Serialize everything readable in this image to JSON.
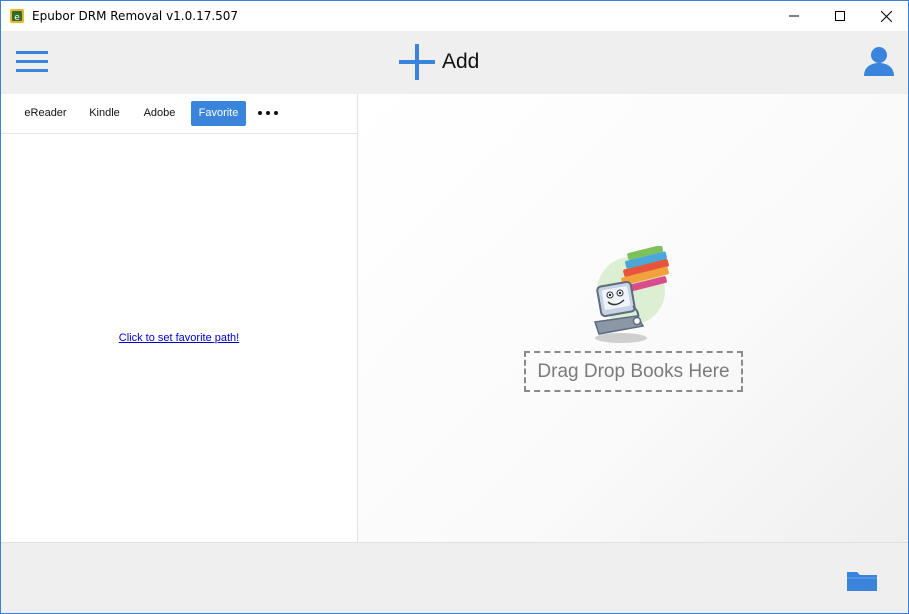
{
  "window": {
    "title": "Epubor DRM Removal v1.0.17.507"
  },
  "toolbar": {
    "add_label": "Add"
  },
  "tabs": [
    {
      "label": "eReader",
      "active": false
    },
    {
      "label": "Kindle",
      "active": false
    },
    {
      "label": "Adobe",
      "active": false
    },
    {
      "label": "Favorite",
      "active": true
    }
  ],
  "left_panel": {
    "favorite_link": "Click to set favorite path!"
  },
  "dropzone": {
    "label": "Drag Drop Books Here"
  },
  "colors": {
    "accent": "#3b84dc",
    "toolbar_bg": "#efefef",
    "link": "#0000cc"
  },
  "icons": {
    "menu": "hamburger-menu-icon",
    "add": "plus-icon",
    "user": "user-icon",
    "more": "more-dots-icon",
    "folder": "folder-icon",
    "minimize": "minimize-icon",
    "maximize": "maximize-icon",
    "close": "close-icon"
  }
}
